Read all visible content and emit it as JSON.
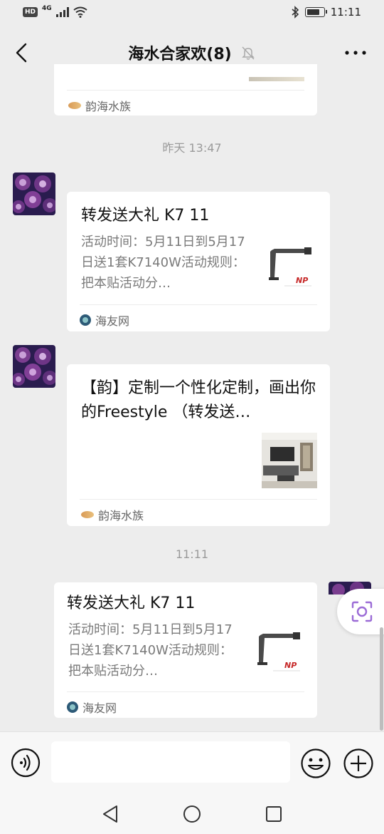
{
  "status_bar": {
    "hd_badge": "HD",
    "network": "4G",
    "time": "11:11",
    "battery_level": 0.8
  },
  "header": {
    "title": "海水合家欢(8)",
    "back_icon": "chevron-left-icon",
    "mute_icon": "bell-muted-icon",
    "more_icon": "more-dots-icon"
  },
  "messages": [
    {
      "type": "link-card-partial",
      "source": "韵海水族"
    },
    {
      "type": "timestamp",
      "text": "昨天 13:47"
    },
    {
      "type": "link-card",
      "sender": "other",
      "title": "转发送大礼 K7 11",
      "description": "活动时间：5月11日到5月17日送1套K7140W活动规则：把本贴活动分…",
      "thumb_logo": "NP",
      "source": "海友网"
    },
    {
      "type": "link-card",
      "sender": "other",
      "title": "【韵】定制一个性化定制，画出你的Freestyle （转发送…",
      "source": "韵海水族"
    },
    {
      "type": "timestamp",
      "text": "11:11"
    },
    {
      "type": "link-card",
      "sender": "self",
      "title": "转发送大礼 K7 11",
      "description": "活动时间：5月11日到5月17日送1套K7140W活动规则：把本贴活动分…",
      "thumb_logo": "NP",
      "source": "海友网"
    }
  ],
  "input_bar": {
    "text_value": "",
    "voice_icon": "voice-icon",
    "emoji_icon": "emoji-icon",
    "plus_icon": "plus-circle-icon"
  },
  "floating": {
    "scan_icon": "scan-lens-icon"
  },
  "colors": {
    "background": "#ededed",
    "card": "#ffffff",
    "scan_accent": "#9b6bd6"
  }
}
